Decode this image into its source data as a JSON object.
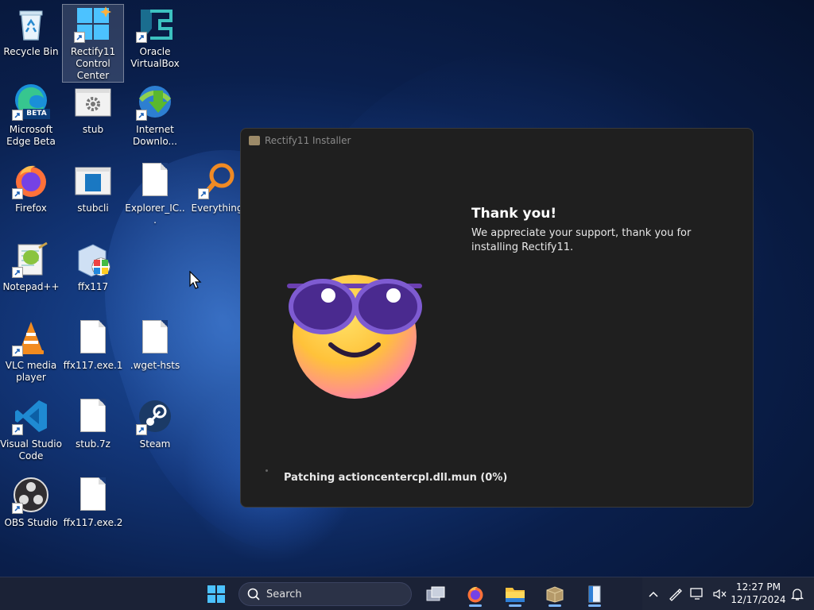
{
  "desktop": {
    "icons": [
      {
        "label": "Recycle Bin",
        "icon": "recycle-bin-icon"
      },
      {
        "label": "Rectify11 Control Center",
        "icon": "rectify11-icon"
      },
      {
        "label": "Oracle VirtualBox",
        "icon": "virtualbox-icon"
      },
      {
        "label": "Microsoft Edge Beta",
        "icon": "edge-beta-icon"
      },
      {
        "label": "stub",
        "icon": "gear-file-icon"
      },
      {
        "label": "Internet Downlo...",
        "icon": "idm-icon"
      },
      {
        "label": "Firefox",
        "icon": "firefox-icon"
      },
      {
        "label": "stubcli",
        "icon": "window-file-icon"
      },
      {
        "label": "Explorer_IC...",
        "icon": "file-icon"
      },
      {
        "label": "Everything",
        "icon": "magnifier-icon"
      },
      {
        "label": "Notepad++",
        "icon": "notepadpp-icon"
      },
      {
        "label": "ffx117",
        "icon": "installer-icon"
      },
      {
        "label": "VLC media player",
        "icon": "vlc-icon"
      },
      {
        "label": "ffx117.exe.1",
        "icon": "file-icon"
      },
      {
        "label": ".wget-hsts",
        "icon": "file-icon"
      },
      {
        "label": "Visual Studio Code",
        "icon": "vscode-icon"
      },
      {
        "label": "stub.7z",
        "icon": "file-icon"
      },
      {
        "label": "Steam",
        "icon": "steam-icon"
      },
      {
        "label": "OBS Studio",
        "icon": "obs-icon"
      },
      {
        "label": "ffx117.exe.2",
        "icon": "file-icon"
      }
    ],
    "beta_badge": "BETA"
  },
  "installer": {
    "title": "Rectify11 Installer",
    "heading": "Thank you!",
    "message": "We appreciate your support, thank you for installing Rectify11.",
    "status": "Patching actioncentercpl.dll.mun (0%)",
    "progress_percent": 0
  },
  "taskbar": {
    "search_placeholder": "Search",
    "apps": [
      "task-view-icon",
      "firefox-icon",
      "file-explorer-icon",
      "installer-box-icon",
      "notepad-icon"
    ],
    "time": "12:27 PM",
    "date": "12/17/2024"
  },
  "colors": {
    "accent": "#7bb6ff",
    "installer_bg": "#1f1f1f",
    "taskbar_bg": "#1b2236"
  }
}
